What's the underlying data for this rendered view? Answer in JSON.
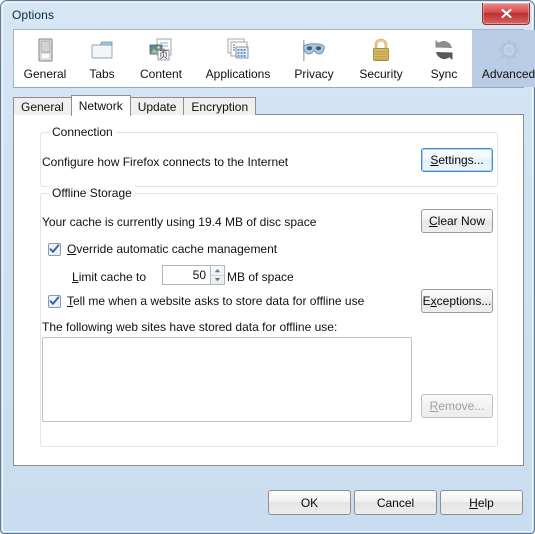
{
  "window": {
    "title": "Options",
    "close_label": "Close"
  },
  "toolbar": {
    "items": [
      {
        "label": "General",
        "icon": "general-icon",
        "selected": false
      },
      {
        "label": "Tabs",
        "icon": "tabs-icon",
        "selected": false
      },
      {
        "label": "Content",
        "icon": "content-icon",
        "selected": false
      },
      {
        "label": "Applications",
        "icon": "applications-icon",
        "selected": false
      },
      {
        "label": "Privacy",
        "icon": "privacy-mask-icon",
        "selected": false
      },
      {
        "label": "Security",
        "icon": "padlock-icon",
        "selected": false
      },
      {
        "label": "Sync",
        "icon": "sync-arrows-icon",
        "selected": false
      },
      {
        "label": "Advanced",
        "icon": "gear-icon",
        "selected": true
      }
    ]
  },
  "tabs": {
    "items": [
      {
        "label": "General",
        "active": false
      },
      {
        "label": "Network",
        "active": true
      },
      {
        "label": "Update",
        "active": false
      },
      {
        "label": "Encryption",
        "active": false
      }
    ]
  },
  "connection": {
    "legend": "Connection",
    "description": "Configure how Firefox connects to the Internet",
    "settings_button": "Settings...",
    "settings_accesskey": "S"
  },
  "offline_storage": {
    "legend": "Offline Storage",
    "cache_usage_text": "Your cache is currently using 19.4 MB of disc space",
    "clear_now_button": "Clear Now",
    "clear_now_accesskey": "C",
    "override_checkbox": {
      "label": "Override automatic cache management",
      "accesskey": "O",
      "checked": true
    },
    "limit_cache_label": "Limit cache to",
    "limit_cache_accesskey": "L",
    "limit_cache_value": "50",
    "limit_cache_suffix": "MB of space",
    "tell_me_checkbox": {
      "label": "Tell me when a website asks to store data for offline use",
      "accesskey": "T",
      "checked": true
    },
    "exceptions_button": "Exceptions...",
    "exceptions_accesskey": "x",
    "sites_list_label": "The following web sites have stored data for offline use:",
    "sites_list_items": [],
    "remove_button": "Remove...",
    "remove_accesskey": "R",
    "remove_disabled": true
  },
  "footer": {
    "ok_button": "OK",
    "cancel_button": "Cancel",
    "help_button": "Help",
    "help_accesskey": "H"
  },
  "colors": {
    "window_chrome": "#cfe1f2",
    "selected_tab_bg": "#b9cce4",
    "focus_border": "#3c8ad2",
    "close_button_red": "#bc2e2e",
    "checkbox_check": "#2d62b5"
  }
}
